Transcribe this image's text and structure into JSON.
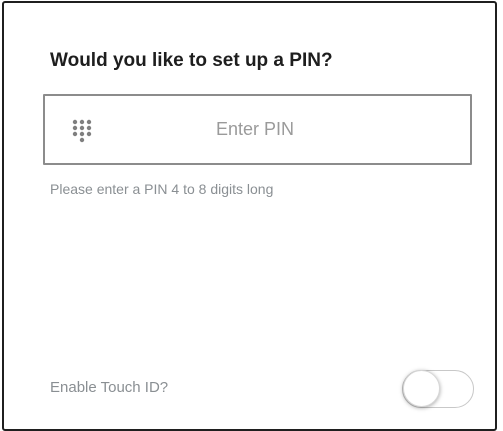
{
  "dialog": {
    "title": "Would you like to set up a PIN?",
    "pin_field": {
      "placeholder": "Enter PIN",
      "value": "",
      "icon": "keypad-icon"
    },
    "hint": "Please enter a PIN 4 to 8 digits long",
    "touch_id": {
      "label": "Enable Touch ID?",
      "enabled": false
    }
  },
  "colors": {
    "title_text": "#1e1e1e",
    "secondary_text": "#8a8f93",
    "field_border": "#8c8c8c",
    "icon": "#7f7f7f",
    "dialog_border": "#1f1f1f"
  }
}
